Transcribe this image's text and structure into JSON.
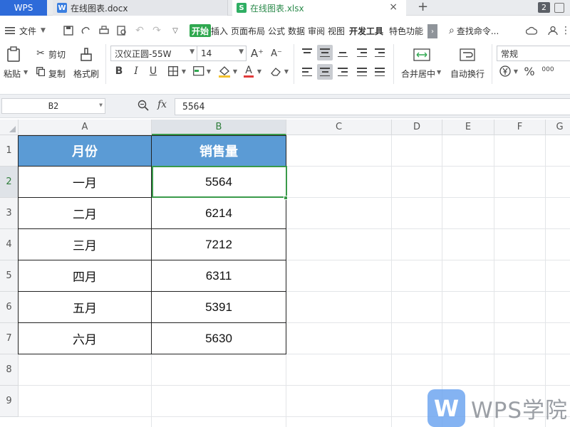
{
  "tabs": {
    "wps_label": "WPS",
    "doc_label": "在线图表.docx",
    "doc_icon": "W",
    "xls_label": "在线图表.xlsx",
    "xls_icon": "S",
    "close_symbol": "×",
    "add_symbol": "+",
    "window_count": "2"
  },
  "menu": {
    "file": "文件",
    "items": [
      "开始",
      "插入",
      "页面布局",
      "公式",
      "数据",
      "审阅",
      "视图",
      "开发工具",
      "特色功能"
    ],
    "more": "›",
    "search": "查找命令..."
  },
  "ribbon": {
    "paste": "粘贴",
    "cut": "剪切",
    "copy": "复制",
    "format_painter": "格式刷",
    "font_name": "汉仪正圆-55W",
    "font_size": "14",
    "bold": "B",
    "italic": "I",
    "underline": "U",
    "font_color_letter": "A",
    "merge_center": "合并居中",
    "wrap_text": "自动换行",
    "number_format": "常规",
    "percent": "%",
    "thousands": "000"
  },
  "formula_bar": {
    "name_box": "B2",
    "fx": "fx",
    "value": "5564"
  },
  "sheet": {
    "columns": [
      "A",
      "B",
      "C",
      "D",
      "E",
      "F",
      "G"
    ],
    "rows": [
      "1",
      "2",
      "3",
      "4",
      "5",
      "6",
      "7",
      "8",
      "9"
    ],
    "header": [
      "月份",
      "销售量"
    ],
    "data": [
      [
        "一月",
        "5564"
      ],
      [
        "二月",
        "6214"
      ],
      [
        "三月",
        "7212"
      ],
      [
        "四月",
        "6311"
      ],
      [
        "五月",
        "5391"
      ],
      [
        "六月",
        "5630"
      ]
    ],
    "selected_cell": "B2",
    "header_color": "#5b9bd5",
    "selection_color": "#3a9a4a"
  },
  "watermark": {
    "logo": "W",
    "text": "WPS学院"
  }
}
